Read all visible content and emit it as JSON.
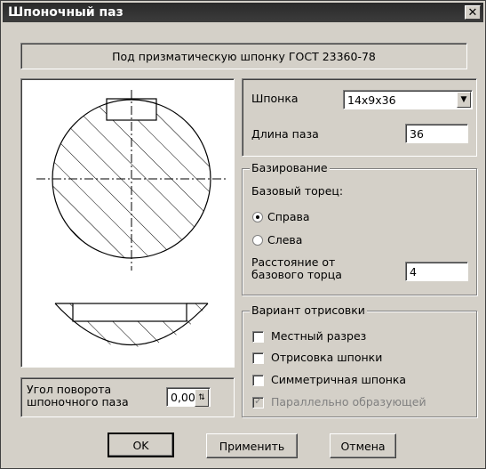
{
  "window": {
    "title": "Шпоночный паз",
    "close_glyph": "✕"
  },
  "header": {
    "text": "Под призматическую шпонку ГОСТ 23360-78"
  },
  "params": {
    "key_label": "Шпонка",
    "key_value": "14x9x36",
    "length_label": "Длина паза",
    "length_value": "36"
  },
  "basing": {
    "title": "Базирование",
    "base_face_label": "Базовый торец:",
    "right_label": "Справа",
    "left_label": "Слева",
    "distance_label_line1": "Расстояние от",
    "distance_label_line2": "базового торца",
    "distance_value": "4",
    "selected": "right"
  },
  "draw_options": {
    "title": "Вариант отрисовки",
    "local_section": "Местный разрез",
    "draw_key": "Отрисовка шпонки",
    "symmetric_key": "Симметричная шпонка",
    "parallel_generatrix": "Параллельно образующей"
  },
  "angle": {
    "label_line1": "Угол поворота",
    "label_line2": "шпоночного паза",
    "value": "0,00"
  },
  "buttons": {
    "ok": "OK",
    "apply": "Применить",
    "cancel": "Отмена"
  },
  "icons": {
    "close": "close-icon",
    "dropdown": "chevron-down-icon",
    "spin": "spin-updown-icon"
  }
}
